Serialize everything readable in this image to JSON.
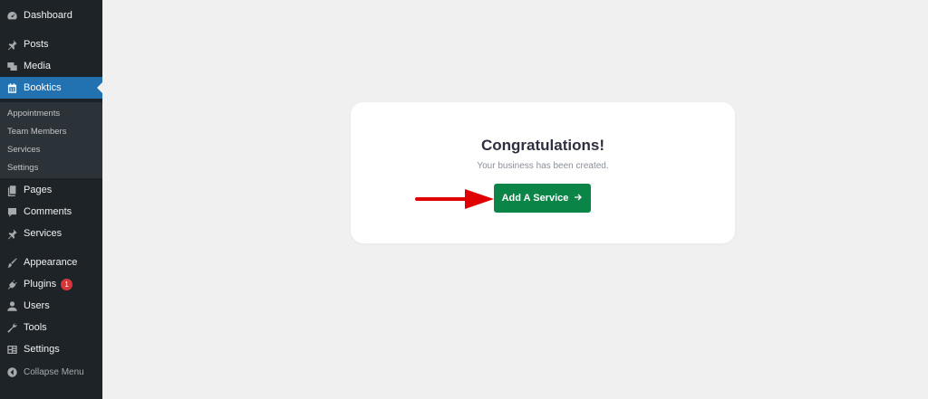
{
  "sidebar": {
    "items": [
      {
        "label": "Dashboard",
        "icon": "dashboard-icon"
      },
      {
        "label": "Posts",
        "icon": "pin-icon"
      },
      {
        "label": "Media",
        "icon": "media-icon"
      },
      {
        "label": "Booktics",
        "icon": "calendar-icon",
        "active": true
      },
      {
        "label": "Pages",
        "icon": "pages-icon"
      },
      {
        "label": "Comments",
        "icon": "comment-icon"
      },
      {
        "label": "Services",
        "icon": "pin-icon"
      },
      {
        "label": "Appearance",
        "icon": "brush-icon"
      },
      {
        "label": "Plugins",
        "icon": "plugin-icon",
        "badge": "1"
      },
      {
        "label": "Users",
        "icon": "user-icon"
      },
      {
        "label": "Tools",
        "icon": "wrench-icon"
      },
      {
        "label": "Settings",
        "icon": "settings-icon"
      }
    ],
    "submenu": [
      "Appointments",
      "Team Members",
      "Services",
      "Settings"
    ],
    "collapse_label": "Collapse Menu"
  },
  "card": {
    "title": "Congratulations!",
    "subtitle": "Your business has been created.",
    "button_label": "Add A Service",
    "button_icon": "arrow-right-icon"
  },
  "colors": {
    "sidebar_bg": "#1d2327",
    "active_bg": "#2271b1",
    "button_bg": "#0b8448",
    "annotation_arrow": "#e10000"
  }
}
